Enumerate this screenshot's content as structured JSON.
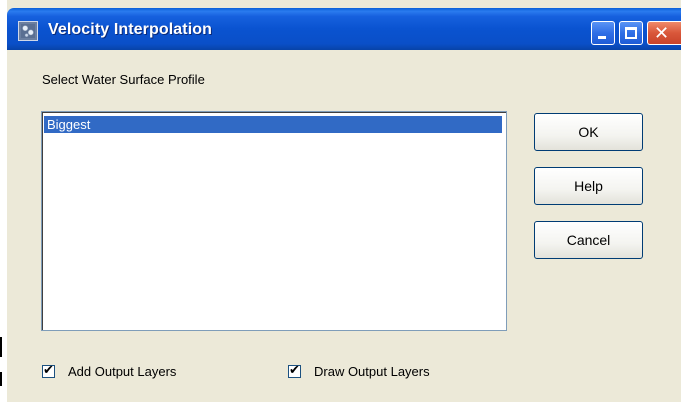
{
  "window": {
    "title": "Velocity Interpolation",
    "icon": "app-icon",
    "controls": {
      "minimize": "minimize-icon",
      "maximize": "maximize-icon",
      "close": "close-icon",
      "close_glyph": "✕"
    }
  },
  "main": {
    "select_label": "Select Water Surface Profile",
    "profiles": [
      {
        "label": "Biggest",
        "selected": true
      }
    ]
  },
  "buttons": {
    "ok": "OK",
    "help": "Help",
    "cancel": "Cancel"
  },
  "options": {
    "add_output_layers": {
      "label": "Add Output Layers",
      "checked": true,
      "mark": "✔"
    },
    "draw_output_layers": {
      "label": "Draw Output Layers",
      "checked": true,
      "mark": "✔"
    }
  },
  "colors": {
    "titlebar": "#0A53D0",
    "selection": "#316AC5",
    "dialog_bg": "#ECE9D8"
  }
}
